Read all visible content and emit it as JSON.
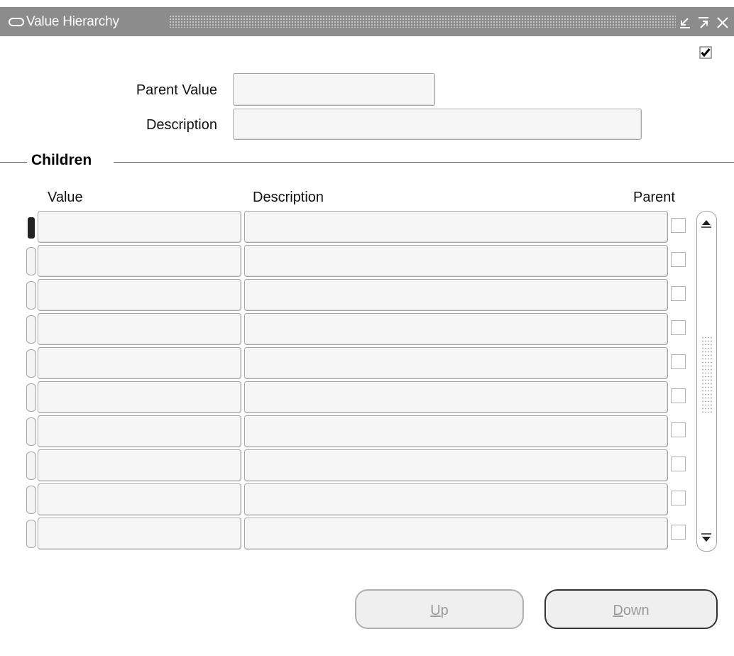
{
  "window": {
    "title": "Value Hierarchy",
    "icons": [
      "window-app-icon",
      "minimize-icon",
      "maximize-icon",
      "close-icon"
    ]
  },
  "form": {
    "corner_checkbox_checked": true,
    "parent_value_label": "Parent Value",
    "parent_value": "",
    "description_label": "Description",
    "description": ""
  },
  "children": {
    "group_title": "Children",
    "columns": {
      "value": "Value",
      "description": "Description",
      "parent": "Parent"
    },
    "rows": [
      {
        "value": "",
        "description": "",
        "parent": false,
        "current": true
      },
      {
        "value": "",
        "description": "",
        "parent": false,
        "current": false
      },
      {
        "value": "",
        "description": "",
        "parent": false,
        "current": false
      },
      {
        "value": "",
        "description": "",
        "parent": false,
        "current": false
      },
      {
        "value": "",
        "description": "",
        "parent": false,
        "current": false
      },
      {
        "value": "",
        "description": "",
        "parent": false,
        "current": false
      },
      {
        "value": "",
        "description": "",
        "parent": false,
        "current": false
      },
      {
        "value": "",
        "description": "",
        "parent": false,
        "current": false
      },
      {
        "value": "",
        "description": "",
        "parent": false,
        "current": false
      },
      {
        "value": "",
        "description": "",
        "parent": false,
        "current": false
      }
    ]
  },
  "buttons": {
    "up_mnemonic": "U",
    "up_rest": "p",
    "down_mnemonic": "D",
    "down_rest": "own"
  },
  "colors": {
    "titlebar": "#8c8c8c",
    "field_bg": "#f6f6f6",
    "field_border": "#a4a4a4",
    "disabled_text": "#9a9a9a"
  }
}
